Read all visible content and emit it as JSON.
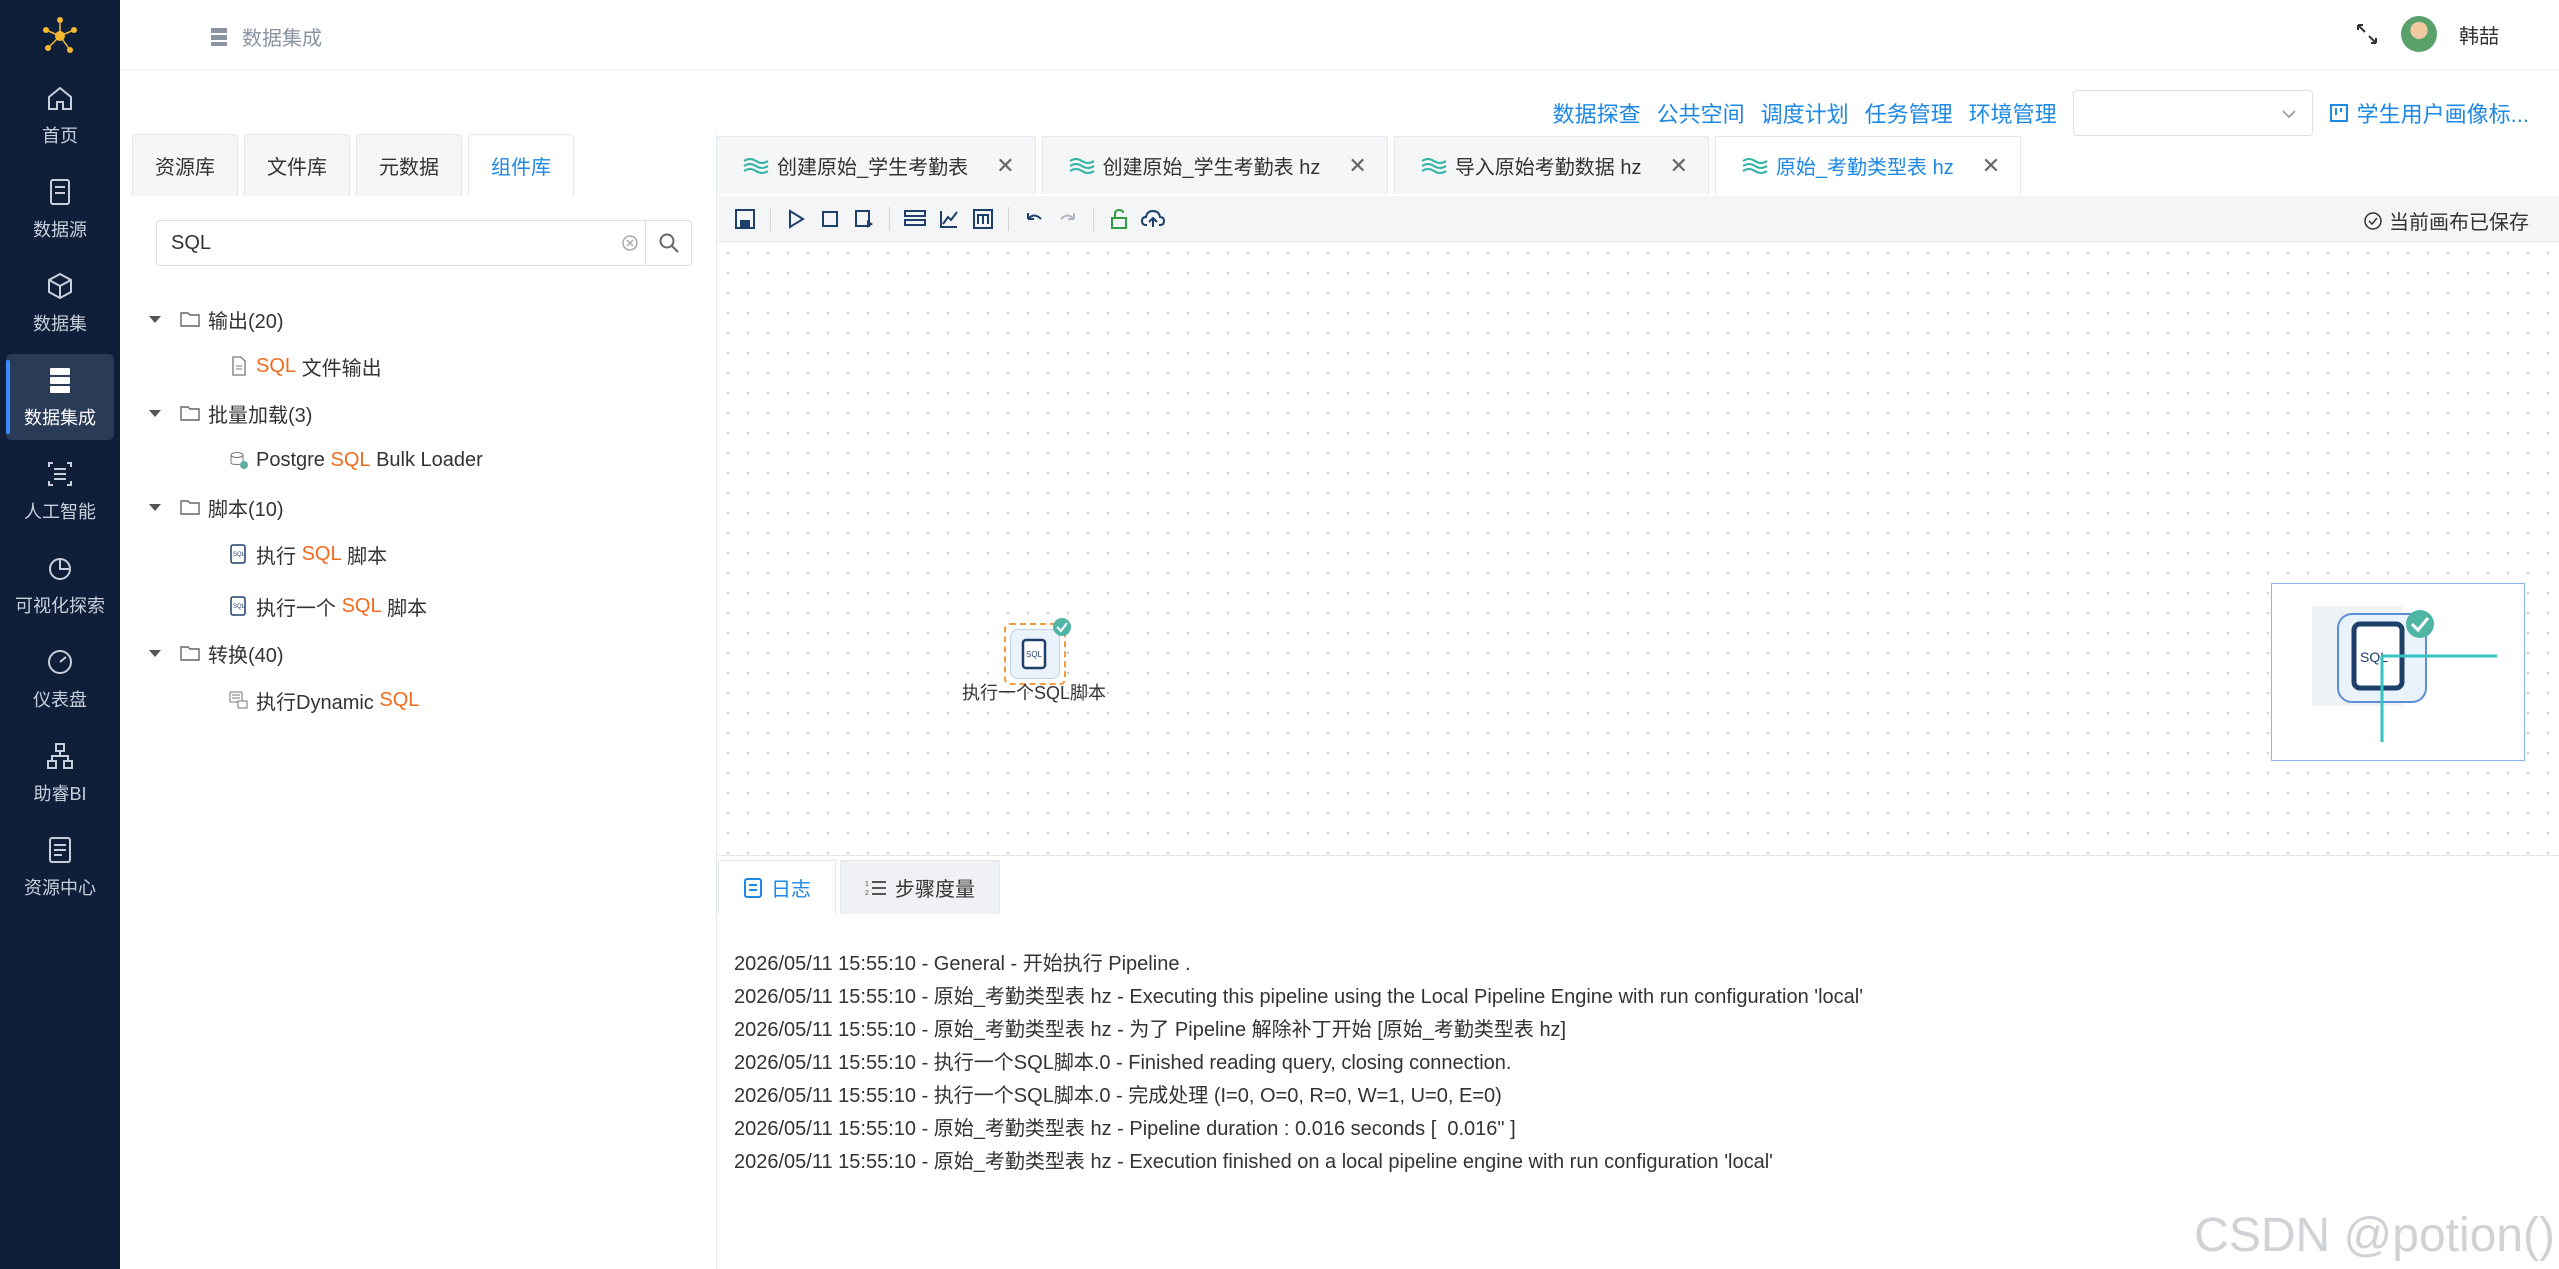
{
  "nav": {
    "items": [
      {
        "label": "首页",
        "icon": "home-icon"
      },
      {
        "label": "数据源",
        "icon": "datasource-icon"
      },
      {
        "label": "数据集",
        "icon": "dataset-icon"
      },
      {
        "label": "数据集成",
        "icon": "integration-icon",
        "active": true
      },
      {
        "label": "人工智能",
        "icon": "ai-icon"
      },
      {
        "label": "可视化探索",
        "icon": "chart-icon"
      },
      {
        "label": "仪表盘",
        "icon": "dashboard-icon"
      },
      {
        "label": "助睿BI",
        "icon": "bi-icon"
      },
      {
        "label": "资源中心",
        "icon": "resource-icon"
      }
    ]
  },
  "topbar": {
    "breadcrumb": "数据集成",
    "user_name": "韩喆"
  },
  "sublinks": {
    "explore": "数据探查",
    "public_space": "公共空间",
    "schedule": "调度计划",
    "tasks": "任务管理",
    "env": "环境管理",
    "select_value": "",
    "project": "学生用户画像标..."
  },
  "left_tabs": [
    "资源库",
    "文件库",
    "元数据",
    "组件库"
  ],
  "search": {
    "value": "SQL"
  },
  "tree": [
    {
      "label": "输出(20)",
      "children": [
        {
          "pre": "",
          "hl": "SQL",
          "post": " 文件输出"
        }
      ]
    },
    {
      "label": "批量加载(3)",
      "children": [
        {
          "pre": "Postgre ",
          "hl": "SQL",
          "post": " Bulk Loader"
        }
      ]
    },
    {
      "label": "脚本(10)",
      "children": [
        {
          "pre": "执行 ",
          "hl": "SQL",
          "post": " 脚本"
        },
        {
          "pre": "执行一个 ",
          "hl": "SQL",
          "post": " 脚本"
        }
      ]
    },
    {
      "label": "转换(40)",
      "children": [
        {
          "pre": "执行Dynamic ",
          "hl": "SQL",
          "post": ""
        }
      ]
    }
  ],
  "editor_tabs": [
    {
      "label": "创建原始_学生考勤表"
    },
    {
      "label": "创建原始_学生考勤表 hz"
    },
    {
      "label": "导入原始考勤数据 hz"
    },
    {
      "label": "原始_考勤类型表 hz",
      "active": true
    }
  ],
  "toolbar": {
    "saved_status": "当前画布已保存"
  },
  "canvas": {
    "node_label": "执行一个SQL脚本"
  },
  "bottom_tabs": [
    "日志",
    "步骤度量"
  ],
  "logs": [
    "2026/05/11 15:55:10 - General - 开始执行 Pipeline .",
    "2026/05/11 15:55:10 - 原始_考勤类型表 hz - Executing this pipeline using the Local Pipeline Engine with run configuration 'local'",
    "2026/05/11 15:55:10 - 原始_考勤类型表 hz - 为了 Pipeline 解除补丁开始 [原始_考勤类型表 hz]",
    "2026/05/11 15:55:10 - 执行一个SQL脚本.0 - Finished reading query, closing connection.",
    "2026/05/11 15:55:10 - 执行一个SQL脚本.0 - 完成处理 (I=0, O=0, R=0, W=1, U=0, E=0)",
    "2026/05/11 15:55:10 - 原始_考勤类型表 hz - Pipeline duration : 0.016 seconds [  0.016\" ]",
    "2026/05/11 15:55:10 - 原始_考勤类型表 hz - Execution finished on a local pipeline engine with run configuration 'local'"
  ],
  "watermark": "CSDN @potion()",
  "colors": {
    "accent": "#1e88e5",
    "highlight": "#f26b1d",
    "nav_bg": "#0f1f3a"
  }
}
